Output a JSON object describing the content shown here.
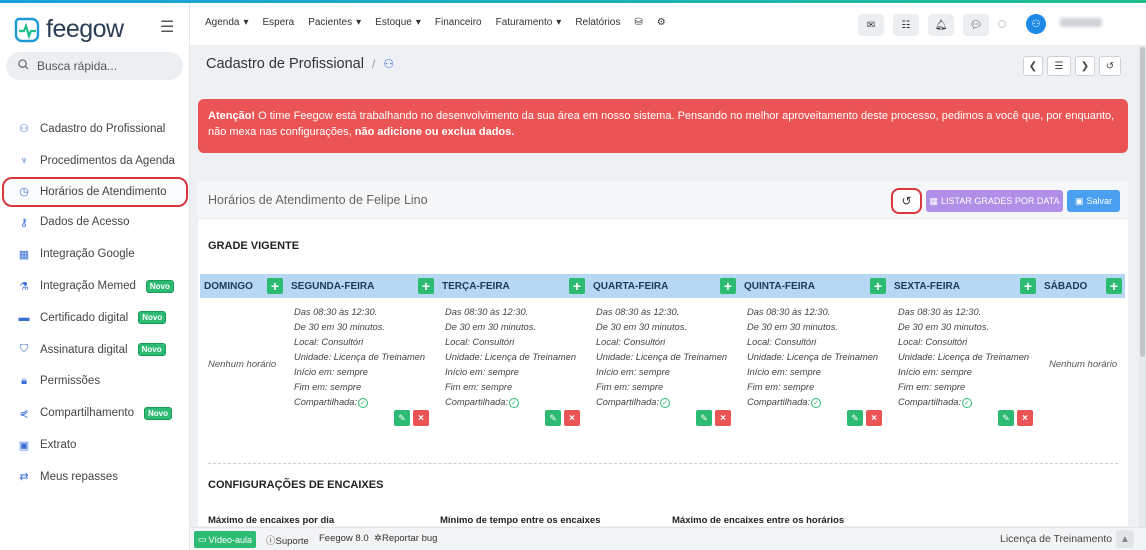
{
  "app": {
    "logo_text": "feegow",
    "accent": "#3a6fd8"
  },
  "search": {
    "placeholder": "Busca rápida..."
  },
  "sidebar": {
    "items": [
      {
        "label": "Cadastro do Profissional",
        "icon": "user-icon"
      },
      {
        "label": "Procedimentos da Agenda",
        "icon": "stethoscope-icon"
      },
      {
        "label": "Horários de Atendimento",
        "icon": "clock-icon",
        "active": true
      },
      {
        "label": "Dados de Acesso",
        "icon": "key-icon"
      },
      {
        "label": "Integração Google",
        "icon": "calendar-icon"
      },
      {
        "label": "Integração Memed",
        "icon": "flask-icon",
        "badge": "Novo"
      },
      {
        "label": "Certificado digital",
        "icon": "card-icon",
        "badge": "Novo"
      },
      {
        "label": "Assinatura digital",
        "icon": "shield-icon",
        "badge": "Novo"
      },
      {
        "label": "Permissões",
        "icon": "lock-icon"
      },
      {
        "label": "Compartilhamento",
        "icon": "share-icon",
        "badge": "Novo"
      },
      {
        "label": "Extrato",
        "icon": "money-icon"
      },
      {
        "label": "Meus repasses",
        "icon": "transfer-icon"
      }
    ]
  },
  "topnav": {
    "items": [
      "Agenda",
      "Espera",
      "Pacientes",
      "Estoque",
      "Financeiro",
      "Faturamento",
      "Relatórios"
    ],
    "dropdown": [
      true,
      false,
      true,
      true,
      false,
      true,
      false
    ]
  },
  "page": {
    "title": "Cadastro de Profissional",
    "separator": "/"
  },
  "alert": {
    "prefix": "Atenção!",
    "text": " O time Feegow está trabalhando no desenvolvimento da sua área em nosso sistema. Pensando no melhor aproveitamento deste processo, pedimos a você que, por enquanto, não mexa nas configurações, ",
    "bold_end": "não adicione ou exclua dados",
    "suffix": "."
  },
  "panel": {
    "title": "Horários de Atendimento de Felipe Lino",
    "list_button": "LISTAR GRADES POR DATA",
    "save_button": "Salvar",
    "section_grade": "GRADE VIGENTE",
    "section_config": "CONFIGURAÇÕES DE ENCAIXES"
  },
  "grade": {
    "days": [
      "DOMINGO",
      "SEGUNDA-FEIRA",
      "TERÇA-FEIRA",
      "QUARTA-FEIRA",
      "QUINTA-FEIRA",
      "SEXTA-FEIRA",
      "SÁBADO"
    ],
    "empty_text": "Nenhum horário",
    "schedule_lines": [
      "Das 08:30 às 12:30.",
      "De 30 em 30 minutos.",
      "Local: Consultóri",
      "Unidade: Licença de Treinamen",
      "Início em: sempre",
      "Fim em: sempre",
      "Compartilhada:"
    ]
  },
  "config": {
    "labels": [
      "Máximo de encaixes por dia",
      "Mínimo de tempo entre os encaixes",
      "Máximo de encaixes entre os horários"
    ]
  },
  "footer": {
    "video": "Vídeo-aula",
    "support": "Suporte",
    "version": "Feegow 8.0",
    "bug": "Reportar bug",
    "license": "Licença de Treinamento"
  }
}
